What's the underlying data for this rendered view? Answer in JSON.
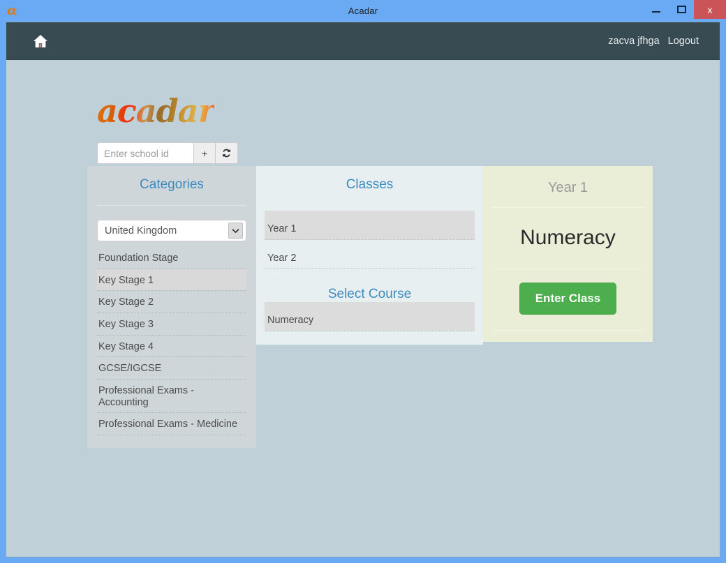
{
  "window": {
    "title": "Acadar",
    "app_icon": "acadar-a-icon",
    "minimize_label": "Minimize",
    "maximize_label": "Maximize",
    "close_label": "x"
  },
  "navbar": {
    "home_icon": "home-icon",
    "user_name": "zacva jfhga",
    "logout_label": "Logout"
  },
  "branding": {
    "logo_text": "acadar"
  },
  "school_bar": {
    "input_value": "",
    "input_placeholder": "Enter school id",
    "add_label": "+",
    "refresh_icon": "refresh-icon"
  },
  "categories": {
    "title": "Categories",
    "country_selected": "United Kingdom",
    "country_options": [
      "United Kingdom"
    ],
    "items": [
      {
        "label": "Foundation Stage",
        "selected": false
      },
      {
        "label": "Key Stage 1",
        "selected": true
      },
      {
        "label": "Key Stage 2",
        "selected": false
      },
      {
        "label": "Key Stage 3",
        "selected": false
      },
      {
        "label": "Key Stage 4",
        "selected": false
      },
      {
        "label": "GCSE/IGCSE",
        "selected": false
      },
      {
        "label": "Professional Exams - Accounting",
        "selected": false
      },
      {
        "label": "Professional Exams - Medicine",
        "selected": false
      }
    ]
  },
  "classes": {
    "title": "Classes",
    "items": [
      {
        "label": "Year 1",
        "selected": true
      },
      {
        "label": "Year 2",
        "selected": false
      }
    ],
    "course_title": "Select Course",
    "courses": [
      {
        "label": "Numeracy",
        "selected": true
      }
    ]
  },
  "course_detail": {
    "year": "Year 1",
    "course_name": "Numeracy",
    "enter_label": "Enter Class"
  },
  "colors": {
    "accent_blue": "#3d8bbd",
    "navbar": "#384b52",
    "page_bg": "#c0d0d8",
    "categories_panel": "#ced6da",
    "classes_panel": "#e7eff0",
    "course_panel": "#eaeed7",
    "enter_button": "#4cae4c",
    "close_button": "#cb5459",
    "window_frame": "#6aa9f4"
  }
}
